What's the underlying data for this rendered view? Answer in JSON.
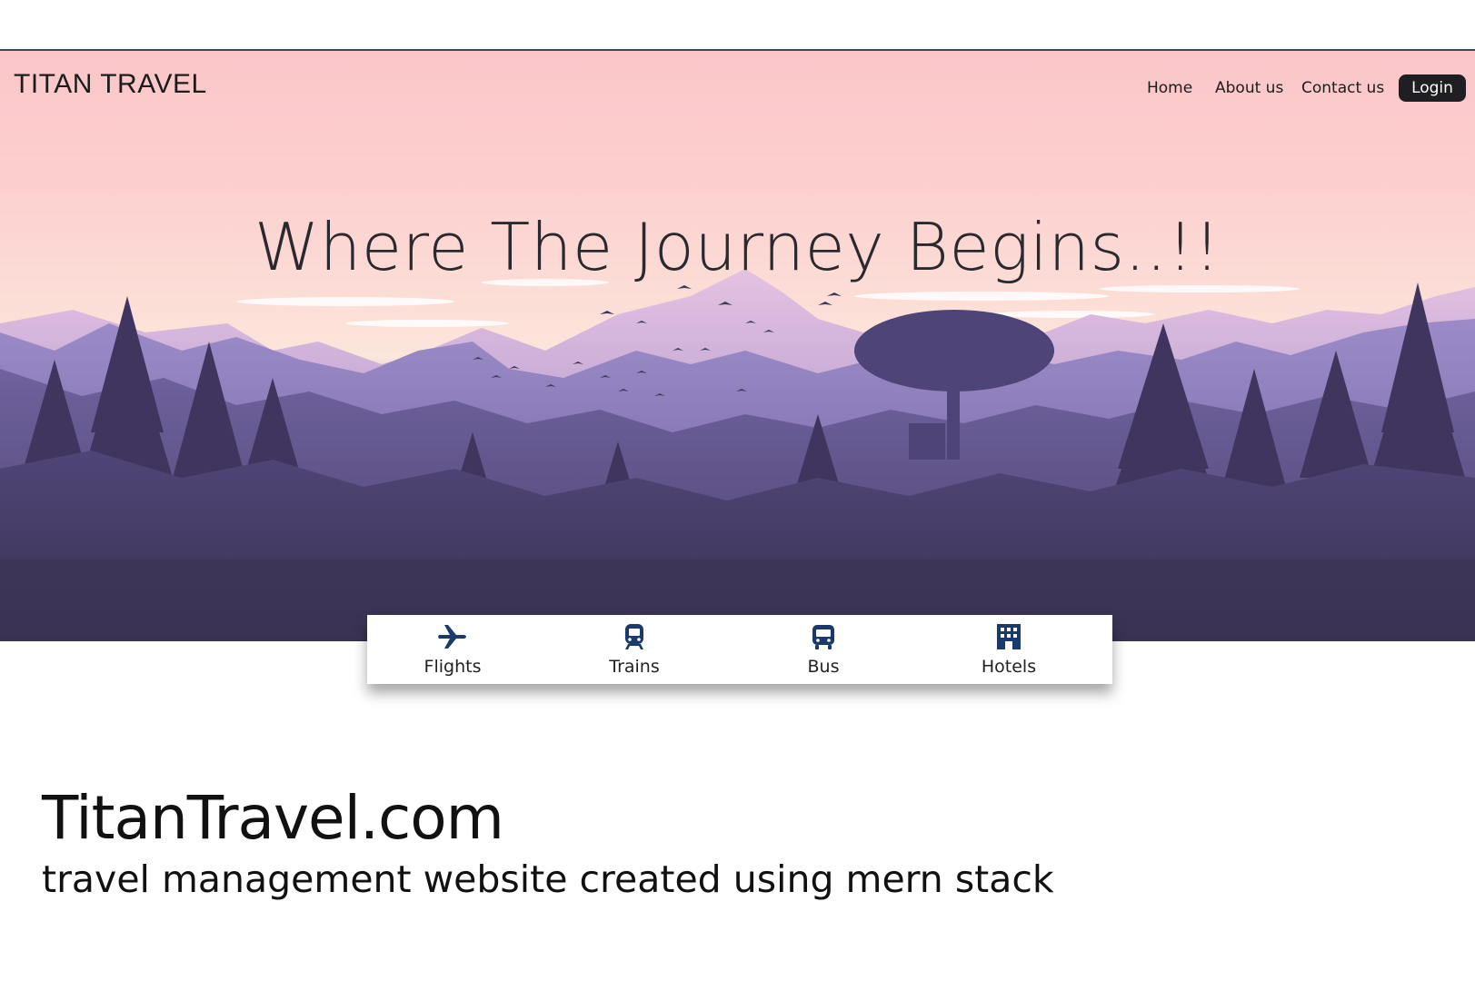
{
  "header": {
    "brand": "TITAN TRAVEL",
    "nav": [
      {
        "label": "Home"
      },
      {
        "label": "About us"
      },
      {
        "label": "Contact us"
      }
    ],
    "login_label": "Login"
  },
  "hero": {
    "headline": "Where The Journey Begins..!!"
  },
  "services": [
    {
      "label": "Flights",
      "icon": "airplane-icon"
    },
    {
      "label": "Trains",
      "icon": "train-icon"
    },
    {
      "label": "Bus",
      "icon": "bus-icon"
    },
    {
      "label": "Hotels",
      "icon": "hotel-icon"
    }
  ],
  "caption": {
    "title": "TitanTravel.com",
    "subtitle": "travel management website created using mern stack"
  },
  "colors": {
    "accent_line": "#2f4f56",
    "login_bg": "#1f1f23",
    "icon_color": "#1a3a6b"
  }
}
